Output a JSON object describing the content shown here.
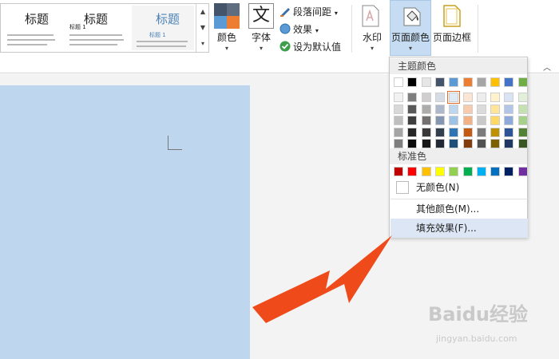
{
  "gallery": {
    "styles": [
      {
        "heading": "标题",
        "sub": "标题 1",
        "colored": false
      },
      {
        "heading": "标题",
        "sub": "标题 1",
        "colored": false
      },
      {
        "heading": "标题",
        "sub": "标题 1",
        "colored": true
      }
    ]
  },
  "ribbon": {
    "colors_label": "颜色",
    "fonts_label": "字体",
    "fonts_glyph": "文",
    "para_spacing_label": "段落间距",
    "effects_label": "效果",
    "set_default_label": "设为默认值",
    "watermark_label": "水印",
    "page_color_label": "页面颜色",
    "page_border_label": "页面边框"
  },
  "dropdown": {
    "theme_header": "主题颜色",
    "standard_header": "标准色",
    "no_color_label": "无颜色(N)",
    "more_colors_label": "其他颜色(M)...",
    "fill_effects_label": "填充效果(F)...",
    "theme_top_row": [
      "#ffffff",
      "#000000",
      "#e7e6e6",
      "#44546a",
      "#5b9bd5",
      "#ed7d31",
      "#a5a5a5",
      "#ffc000",
      "#4472c4",
      "#70ad47"
    ],
    "theme_shades": [
      [
        "#f2f2f2",
        "#7f7f7f",
        "#d0cece",
        "#d6dce4",
        "#deebf6",
        "#fbe5d5",
        "#ededed",
        "#fff2cc",
        "#dae3f3",
        "#e2efd9"
      ],
      [
        "#d8d8d8",
        "#595959",
        "#aeabab",
        "#adb9ca",
        "#bdd7ee",
        "#f7cbac",
        "#dbdbdb",
        "#fee599",
        "#b4c6e7",
        "#c5e0b3"
      ],
      [
        "#bfbfbf",
        "#3f3f3f",
        "#757070",
        "#8496b0",
        "#9cc3e5",
        "#f4b183",
        "#c9c9c9",
        "#ffd965",
        "#8eaadb",
        "#a8d08d"
      ],
      [
        "#a5a5a5",
        "#262626",
        "#3a3838",
        "#323f4f",
        "#2e75b5",
        "#c55a11",
        "#7b7b7b",
        "#bf9000",
        "#2f5496",
        "#538135"
      ],
      [
        "#7f7f7f",
        "#0c0c0c",
        "#171616",
        "#222a35",
        "#1e4e79",
        "#833c0b",
        "#525252",
        "#7f6000",
        "#1f3864",
        "#375623"
      ]
    ],
    "standard_colors": [
      "#c00000",
      "#ff0000",
      "#ffc000",
      "#ffff00",
      "#92d050",
      "#00b050",
      "#00b0f0",
      "#0070c0",
      "#002060",
      "#7030a0"
    ]
  },
  "watermark": {
    "text": "Baidu经验",
    "sub": "jingyan.baidu.com"
  }
}
